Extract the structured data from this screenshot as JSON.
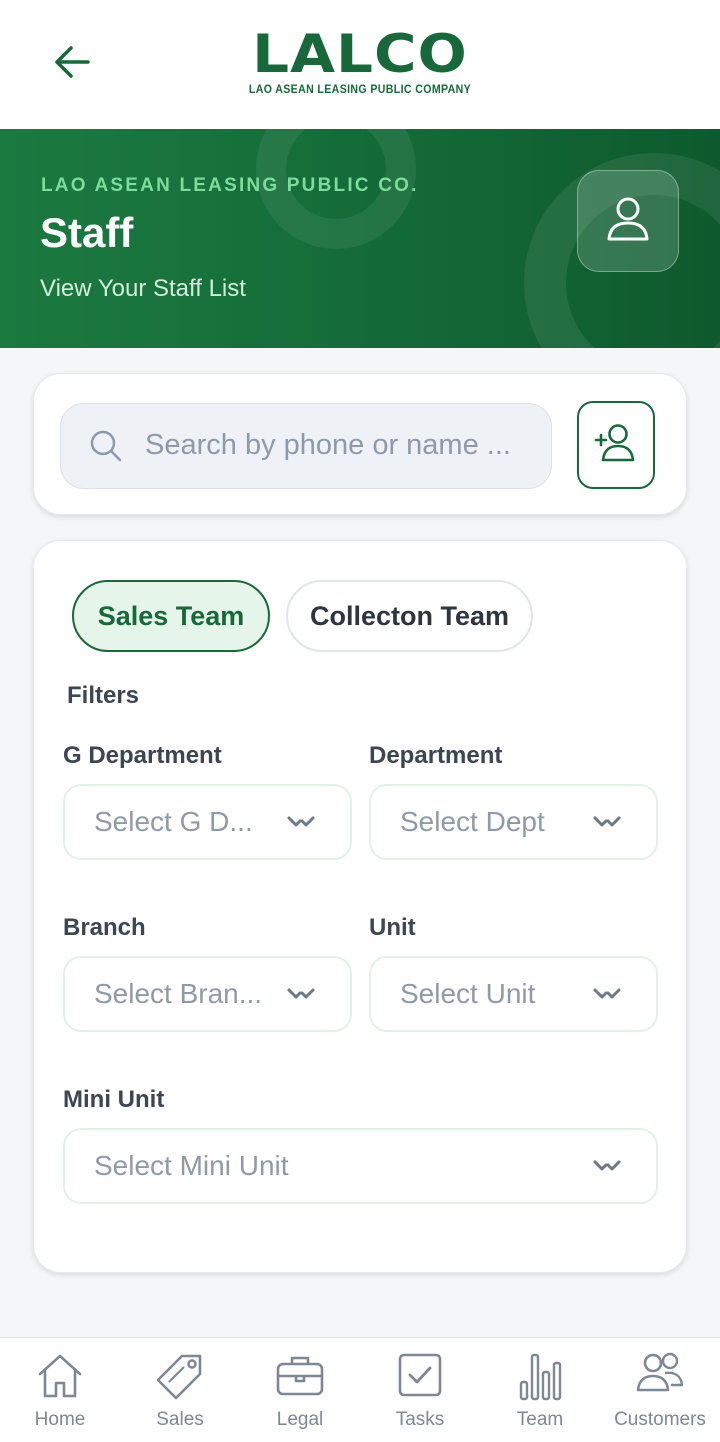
{
  "header": {
    "logo_text": "LALCO",
    "logo_subtitle": "LAO ASEAN LEASING PUBLIC COMPANY"
  },
  "hero": {
    "company": "LAO ASEAN LEASING PUBLIC CO.",
    "title": "Staff",
    "subtitle": "View Your Staff List"
  },
  "search": {
    "placeholder": "Search by phone or name ..."
  },
  "tabs": [
    {
      "label": "Sales Team",
      "active": true
    },
    {
      "label": "Collecton Team",
      "active": false
    }
  ],
  "filters": {
    "heading": "Filters",
    "g_department": {
      "label": "G Department",
      "placeholder": "Select G D..."
    },
    "department": {
      "label": "Department",
      "placeholder": "Select Dept"
    },
    "branch": {
      "label": "Branch",
      "placeholder": "Select Bran..."
    },
    "unit": {
      "label": "Unit",
      "placeholder": "Select Unit"
    },
    "mini_unit": {
      "label": "Mini Unit",
      "placeholder": "Select Mini Unit"
    }
  },
  "bottom_nav": [
    {
      "label": "Home",
      "icon": "home-icon"
    },
    {
      "label": "Sales",
      "icon": "tag-icon"
    },
    {
      "label": "Legal",
      "icon": "briefcase-icon"
    },
    {
      "label": "Tasks",
      "icon": "checkbox-icon"
    },
    {
      "label": "Team",
      "icon": "bar-chart-icon"
    },
    {
      "label": "Customers",
      "icon": "users-icon"
    }
  ],
  "colors": {
    "brand_green": "#17693a",
    "hero_accent": "#7ddc9c",
    "page_bg": "#f4f6f8"
  }
}
